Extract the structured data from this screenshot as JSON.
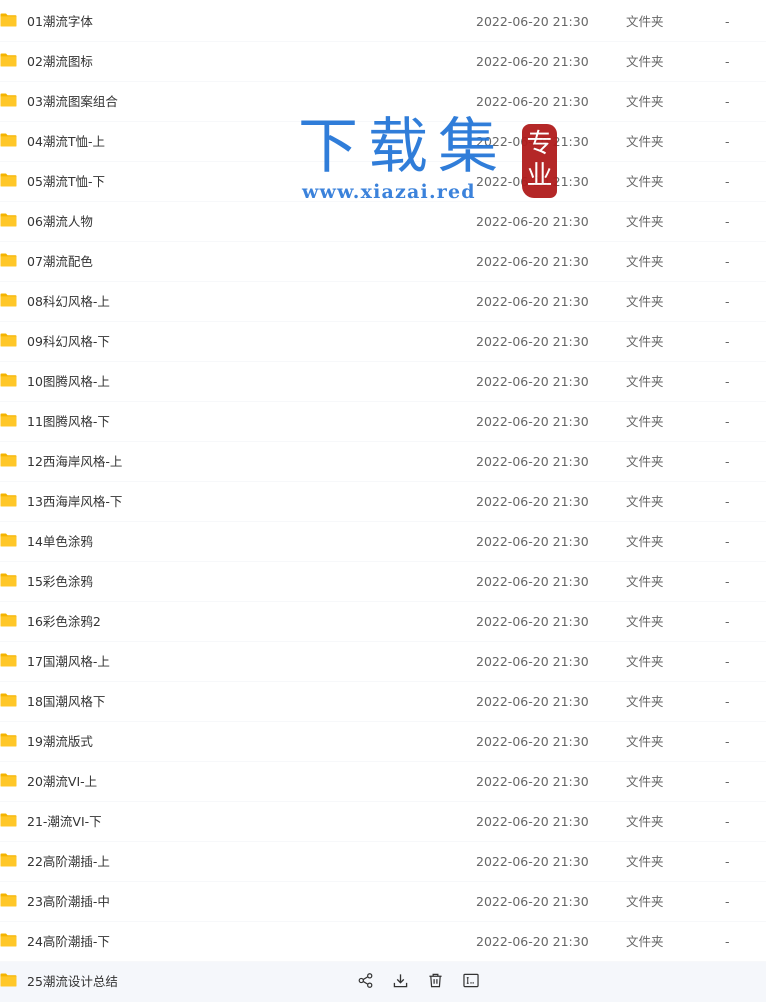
{
  "folders": [
    {
      "name": "01潮流字体",
      "date": "2022-06-20 21:30",
      "type": "文件夹",
      "size": "-"
    },
    {
      "name": "02潮流图标",
      "date": "2022-06-20 21:30",
      "type": "文件夹",
      "size": "-"
    },
    {
      "name": "03潮流图案组合",
      "date": "2022-06-20 21:30",
      "type": "文件夹",
      "size": "-"
    },
    {
      "name": "04潮流T恤-上",
      "date": "2022-06-20 21:30",
      "type": "文件夹",
      "size": "-"
    },
    {
      "name": "05潮流T恤-下",
      "date": "2022-06-20 21:30",
      "type": "文件夹",
      "size": "-"
    },
    {
      "name": "06潮流人物",
      "date": "2022-06-20 21:30",
      "type": "文件夹",
      "size": "-"
    },
    {
      "name": "07潮流配色",
      "date": "2022-06-20 21:30",
      "type": "文件夹",
      "size": "-"
    },
    {
      "name": "08科幻风格-上",
      "date": "2022-06-20 21:30",
      "type": "文件夹",
      "size": "-"
    },
    {
      "name": "09科幻风格-下",
      "date": "2022-06-20 21:30",
      "type": "文件夹",
      "size": "-"
    },
    {
      "name": "10图腾风格-上",
      "date": "2022-06-20 21:30",
      "type": "文件夹",
      "size": "-"
    },
    {
      "name": "11图腾风格-下",
      "date": "2022-06-20 21:30",
      "type": "文件夹",
      "size": "-"
    },
    {
      "name": "12西海岸风格-上",
      "date": "2022-06-20 21:30",
      "type": "文件夹",
      "size": "-"
    },
    {
      "name": "13西海岸风格-下",
      "date": "2022-06-20 21:30",
      "type": "文件夹",
      "size": "-"
    },
    {
      "name": "14单色涂鸦",
      "date": "2022-06-20 21:30",
      "type": "文件夹",
      "size": "-"
    },
    {
      "name": "15彩色涂鸦",
      "date": "2022-06-20 21:30",
      "type": "文件夹",
      "size": "-"
    },
    {
      "name": "16彩色涂鸦2",
      "date": "2022-06-20 21:30",
      "type": "文件夹",
      "size": "-"
    },
    {
      "name": "17国潮风格-上",
      "date": "2022-06-20 21:30",
      "type": "文件夹",
      "size": "-"
    },
    {
      "name": "18国潮风格下",
      "date": "2022-06-20 21:30",
      "type": "文件夹",
      "size": "-"
    },
    {
      "name": "19潮流版式",
      "date": "2022-06-20 21:30",
      "type": "文件夹",
      "size": "-"
    },
    {
      "name": "20潮流VI-上",
      "date": "2022-06-20 21:30",
      "type": "文件夹",
      "size": "-"
    },
    {
      "name": "21-潮流VI-下",
      "date": "2022-06-20 21:30",
      "type": "文件夹",
      "size": "-"
    },
    {
      "name": "22高阶潮插-上",
      "date": "2022-06-20 21:30",
      "type": "文件夹",
      "size": "-"
    },
    {
      "name": "23高阶潮插-中",
      "date": "2022-06-20 21:30",
      "type": "文件夹",
      "size": "-"
    },
    {
      "name": "24高阶潮插-下",
      "date": "2022-06-20 21:30",
      "type": "文件夹",
      "size": "-"
    },
    {
      "name": "25潮流设计总结",
      "date": "",
      "type": "",
      "size": "",
      "hovered": true
    }
  ],
  "hover_actions": [
    {
      "name": "share-icon"
    },
    {
      "name": "download-icon"
    },
    {
      "name": "delete-icon"
    },
    {
      "name": "rename-icon"
    }
  ],
  "watermark": {
    "title": "下载集",
    "url": "www.xiazai.red",
    "seal": "专业"
  },
  "colors": {
    "folder": "#ffc728",
    "folder_back": "#f5b400",
    "watermark_blue": "#1f73d6",
    "seal_red": "#b01c1c",
    "hover_row": "#f5f7fb"
  }
}
